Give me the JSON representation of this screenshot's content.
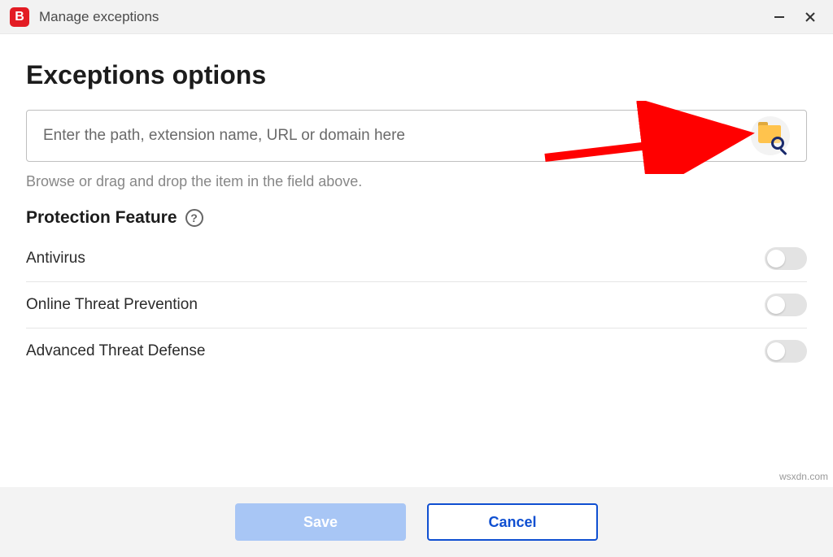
{
  "titlebar": {
    "app_letter": "B",
    "title": "Manage exceptions"
  },
  "page": {
    "heading": "Exceptions options",
    "input_placeholder": "Enter the path, extension name, URL or domain here",
    "hint": "Browse or drag and drop the item in the field above.",
    "section_label": "Protection Feature"
  },
  "features": [
    {
      "label": "Antivirus",
      "on": false
    },
    {
      "label": "Online Threat Prevention",
      "on": false
    },
    {
      "label": "Advanced Threat Defense",
      "on": false
    }
  ],
  "footer": {
    "save": "Save",
    "cancel": "Cancel"
  },
  "watermark": "wsxdn.com"
}
